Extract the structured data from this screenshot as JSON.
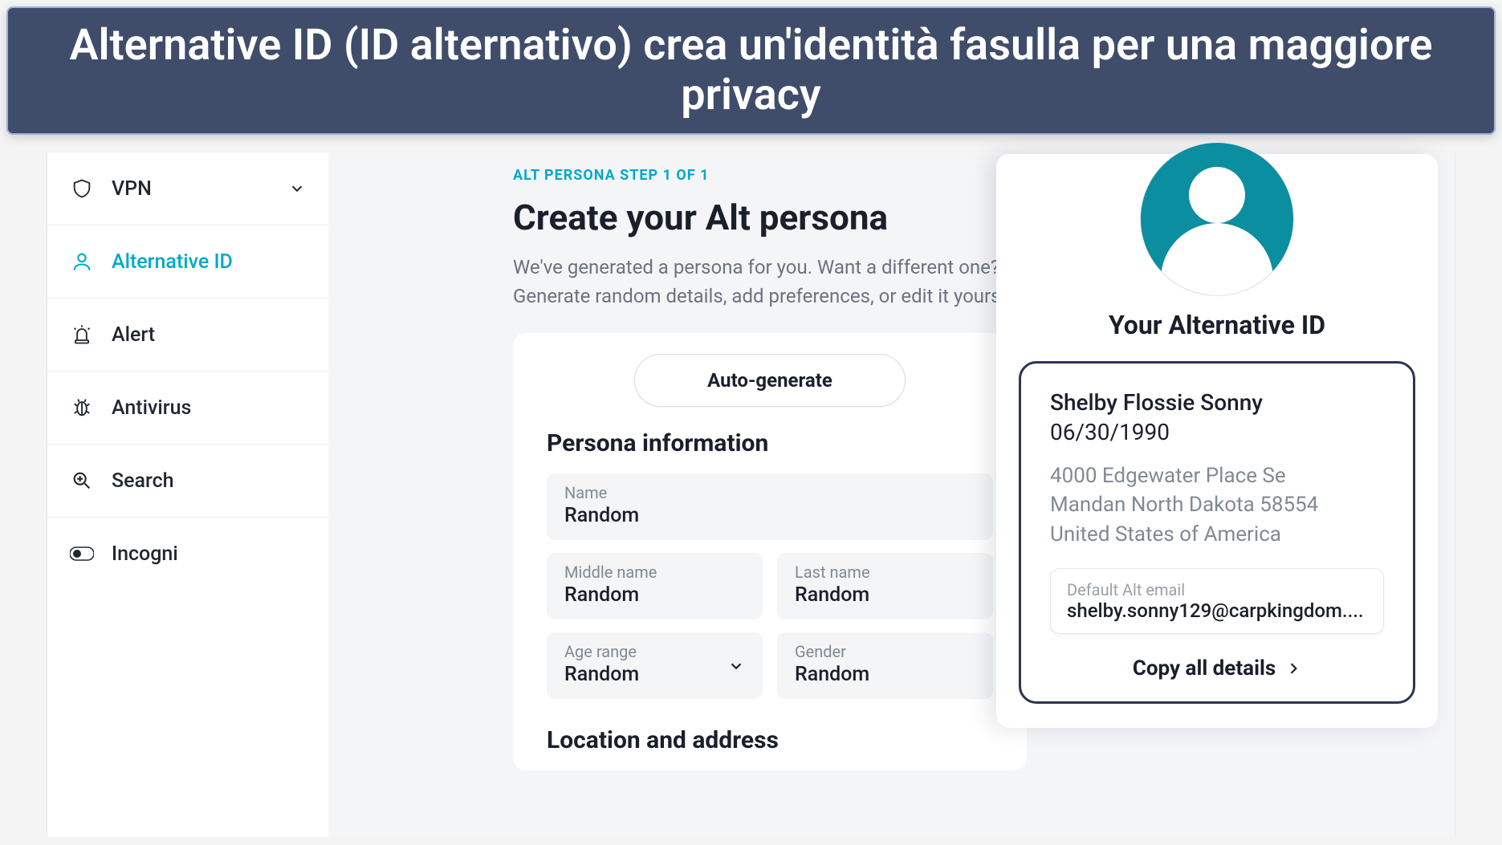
{
  "banner": {
    "text": "Alternative ID (ID alternativo) crea un'identità fasulla per una maggiore privacy"
  },
  "sidebar": {
    "items": [
      {
        "label": "VPN",
        "icon": "shield",
        "hasChevron": true,
        "active": false
      },
      {
        "label": "Alternative ID",
        "icon": "person",
        "hasChevron": false,
        "active": true
      },
      {
        "label": "Alert",
        "icon": "siren",
        "hasChevron": false,
        "active": false
      },
      {
        "label": "Antivirus",
        "icon": "bug",
        "hasChevron": false,
        "active": false
      },
      {
        "label": "Search",
        "icon": "search",
        "hasChevron": false,
        "active": false
      },
      {
        "label": "Incogni",
        "icon": "toggle",
        "hasChevron": false,
        "active": false
      }
    ]
  },
  "main": {
    "step": "ALT PERSONA STEP 1 OF 1",
    "title": "Create your Alt persona",
    "lead": "We've generated a persona for you. Want a different one? Generate random details, add preferences, or edit it yourself.",
    "autoGenerate": "Auto-generate",
    "personaSection": "Persona information",
    "fields": {
      "name": {
        "label": "Name",
        "value": "Random"
      },
      "middleName": {
        "label": "Middle name",
        "value": "Random"
      },
      "lastName": {
        "label": "Last name",
        "value": "Random"
      },
      "ageRange": {
        "label": "Age range",
        "value": "Random"
      },
      "gender": {
        "label": "Gender",
        "value": "Random"
      }
    },
    "locationSection": "Location and address"
  },
  "altid": {
    "title": "Your Alternative ID",
    "name": "Shelby Flossie Sonny",
    "dob": "06/30/1990",
    "address1": "4000 Edgewater Place Se",
    "address2": "Mandan North Dakota 58554",
    "address3": "United States of America",
    "emailLabel": "Default Alt email",
    "email": "shelby.sonny129@carpkingdom....",
    "copy": "Copy all details"
  }
}
